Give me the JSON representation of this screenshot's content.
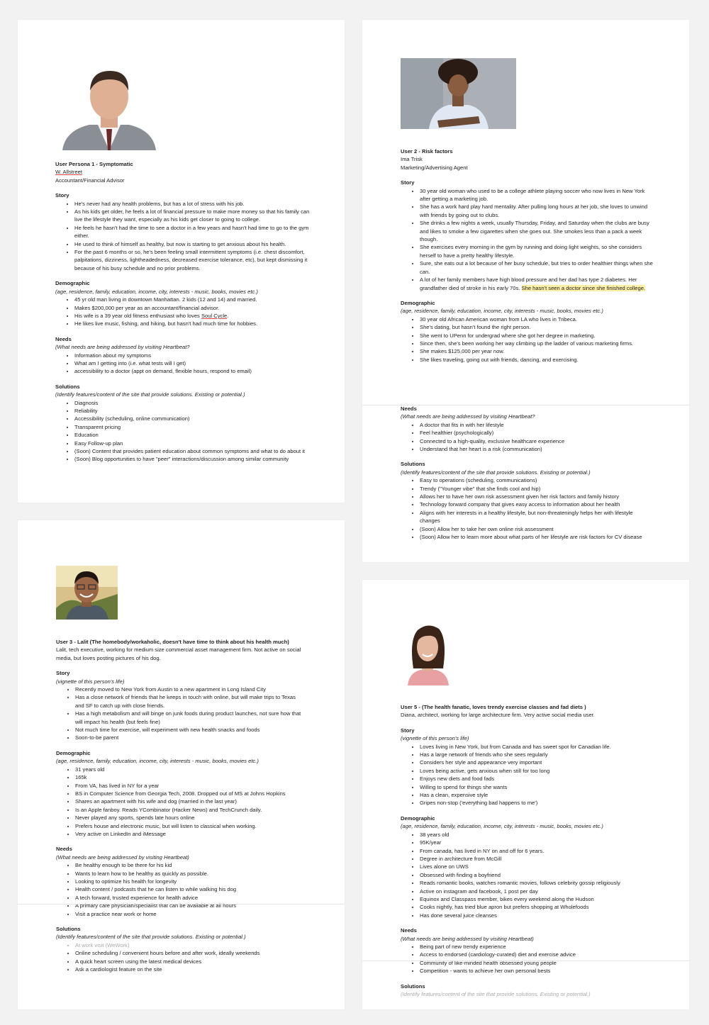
{
  "p1": {
    "title": "User Persona 1 - Symptomatic",
    "name": "W. Allstreet",
    "role": "Accountant/Financial Advisor",
    "story_h": "Story",
    "story": [
      "He's never had any health problems, but has a lot of stress with his job.",
      "As his kids get older, he feels a lot of financial pressure to make more money so that his family can live the lifestyle they want, especially as his kids get closer to going to college.",
      "He feels he hasn't had the time to see a doctor in a few years and hasn't had time to go to the gym either.",
      "He used to think of himself as healthy, but now is starting to get anxious about his health.",
      "For the past 6 months or so, he's been feeling small intermittent symptoms (i.e. chest discomfort, palpitations, dizziness, lightheadedness, decreased exercise tolerance, etc), but kept dismissing it because of his busy schedule and no prior problems."
    ],
    "demo_h": "Demographic",
    "demo_note": "(age, residence, family, education, income, city, interests - music, books, movies etc.)",
    "demo": [
      "45 yr old man living in downtown Manhattan. 2 kids (12 and 14) and married.",
      "Makes $200,000 per year as an accountant/financial advisor.",
      "His wife is a 39 year old fitness enthusiast who loves ",
      "He likes live music, fishing, and hiking, but hasn't had much time for hobbies."
    ],
    "demo_soul": "Soul Cycle",
    "demo_soul_end": ".",
    "needs_h": "Needs",
    "needs_note": "(What needs are being addressed by visiting Heartbeat?",
    "needs": [
      "Information about my symptoms",
      "What am I getting into (i.e. what tests will I get)",
      "accessibility to a doctor (appt on demand, flexible hours, respond to email)"
    ],
    "sol_h": "Solutions",
    "sol_note": "(Identify features/content of the site that provide solutions. Existing or potential.)",
    "sol": [
      "Diagnosis",
      "Reliability",
      "Accessibility (scheduling, online communication)",
      "Transparent pricing",
      "Education",
      "Easy Follow-up plan",
      "(Soon) Content that provides patient education about common symptoms and what to do about it",
      "(Soon) Blog opportunities to have \"peer\" interactions/discussion among similar community"
    ]
  },
  "p2": {
    "title": "User 2 - Risk factors",
    "name": "Ima Trisk",
    "role": "Marketing/Advertising Agent",
    "story_h": "Story",
    "story": [
      "30 year old woman who used to be a college athlete playing soccer who now lives in New York after getting a marketing job.",
      "She has a work hard play hard mentality. After pulling long hours at her job, she loves to unwind with friends by going out to clubs.",
      "She drinks a few nights a week, usually Thursday, Friday, and Saturday when the clubs are busy and likes to smoke a few cigarettes when she goes out. She smokes less than a pack a week though.",
      "She exercises every morning in the gym by running and doing light weights, so she considers herself to have a pretty healthy lifestyle.",
      "Sure, she eats out a lot because of her busy schedule, but tries to order healthier things when she can."
    ],
    "story_last": "A lot of her family members have high blood pressure and her dad has type 2 diabetes. Her grandfather died of stroke in his early 70s. ",
    "story_hl": "She hasn't seen a doctor since she finished college.",
    "demo_h": "Demographic",
    "demo_note": "(age, residence, family, education, income, city, interests - music, books, movies etc.)",
    "demo": [
      "30 year old African American woman from LA who lives in Tribeca.",
      "She's dating, but hasn't found the right person.",
      "She went to UPenn for undergrad where she got her degree in marketing.",
      "Since then, she's been working her way climbing up the ladder of various marketing firms.",
      "She makes $125,000 per year now.",
      "She likes traveling, going out with friends, dancing, and exercising."
    ],
    "needs_h": "Needs",
    "needs_note": "(What needs are being addressed by visiting Heartbeat?",
    "needs": [
      "A doctor that fits in with her lifestyle",
      "Feel healthier (psychologically)",
      "Connected to a high-quality, exclusive healthcare experience",
      "Understand that her heart is a risk (communication)"
    ],
    "sol_h": "Solutions",
    "sol_note": "(Identify features/content of the site that provide solutions. Existing or potential.)",
    "sol": [
      "Easy to operations (scheduling, communications)",
      "Trendy (\"Younger vibe\" that she finds cool and hip)",
      "Allows her to have her own risk assessment given her risk factors and family history",
      "Technology forward company that gives easy access to information about her health",
      "Aligns with her interests in a healthy lifestyle, but non-threateningly helps her with lifestyle changes",
      "(Soon) Allow her to take her own online risk assessment",
      "(Soon) Allow her to learn more about what parts of her lifestyle are risk factors for CV disease"
    ]
  },
  "p3": {
    "title": "User 3 - Lalit (The homebody/workaholic, doesn't have time to think about his health much)",
    "intro": "Lalit, tech executive, working for medium size commercial asset management firm. Not active on social media, but loves posting pictures of his dog.",
    "story_h": "Story",
    "story_note": "(vignette of this person's life)",
    "story": [
      "Recently moved to New York from Austin to a new apartment in Long Island City",
      "Has a close network of friends that he keeps in touch with online, but will make trips to Texas and SF to catch up with close friends.",
      "Has a high metabolism and will binge on junk foods during product launches, not sure how that will impact his health (but feels fine)",
      "Not much time for exercise, will experiment with new health snacks and foods",
      "Soon-to-be parent"
    ],
    "demo_h": "Demographic",
    "demo_note": "(age, residence, family, education, income, city, interests - music, books, movies etc.)",
    "demo": [
      "31 years old",
      "165k",
      "From VA, has lived in NY for a year",
      "BS in Computer Science from Georgia Tech, 2008. Dropped out of MS at Johns Hopkins",
      "Shares an apartment with his wife and dog (married in the last year)",
      "Is an Apple fanboy. Reads YCombinator (Hacker News) and TechCrunch daily.",
      "Never played any sports, spends late hours online",
      "Prefers house and electronic music, but will listen to classical when working.",
      "Very active on LinkedIn and iMessage"
    ],
    "needs_h": "Needs",
    "needs_note": "(What needs are being addressed by visiting Heartbeat)",
    "needs": [
      "Be healthy enough to be there for his kid",
      "Wants to learn how to be healthy as quickly as possible.",
      "Looking to optimize his health for longevity",
      "Health content / podcasts that he can listen to while walking his dog",
      "A tech forward, trusted experience for health advice",
      "A primary care physician/specialist that can be available at all hours",
      "Visit a practice near work or home"
    ],
    "sol_h": "Solutions",
    "sol_note": "(Identify features/content of the site that provide solutions. Existing or potential.)",
    "sol_faded": "At work visit (WeWork)",
    "sol": [
      "Online scheduling / convenient hours before and after work, ideally weekends",
      "A quick heart screen using the latest medical devices",
      "Ask a cardiologist feature on the site"
    ]
  },
  "p5": {
    "title": "User 5 - (The health fanatic, loves trendy exercise classes and fad diets )",
    "intro": "Diana, architect, working for large architecture firm. Very active social media user.",
    "story_h": "Story",
    "story_note": "(vignette of this person's life)",
    "story": [
      "Loves living in New York, but from Canada and has sweet spot for Canadian life.",
      "Has a large network of friends who she sees regularly",
      "Considers her style and appearance very important",
      "Loves being active, gets anxious when still for too long",
      "Enjoys new diets and food fads",
      "Willing to spend for things she wants",
      "Has a clean, expensive style",
      "Gripes non-stop ('everything bad happens to me')"
    ],
    "demo_h": "Demographic",
    "demo_note": "(age, residence, family, education, income, city, interests - music, books, movies etc.)",
    "demo": [
      "38 years old",
      "95K/year",
      "From canada, has lived in NY on and off for 6 years.",
      "Degree in architecture from McGill",
      "Lives alone on UWS",
      "Obsessed with finding a boyfriend",
      "Reads romantic books, watches romantic movies, follows celebrity gossip religiously",
      "Active on instagram and facebook, 1 post per day",
      "Equinox and Classpass member, bikes every weekend along the Hudson",
      "Cooks nightly, has tried blue apron but prefers shopping at Wholefoods",
      "Has done several juice cleanses"
    ],
    "needs_h": "Needs",
    "needs_note": "(What needs are being addressed by visiting Heartbeat)",
    "needs": [
      "Being part of new trendy experience",
      "Access to endorsed (cardiology-curated) diet and exercise advice",
      "Community of like-minded health obsessed young people",
      "Competition - wants to achieve her own personal bests"
    ],
    "sol_h": "Solutions",
    "sol_note": "(Identify features/content of the site that provide solutions. Existing or potential.)"
  }
}
